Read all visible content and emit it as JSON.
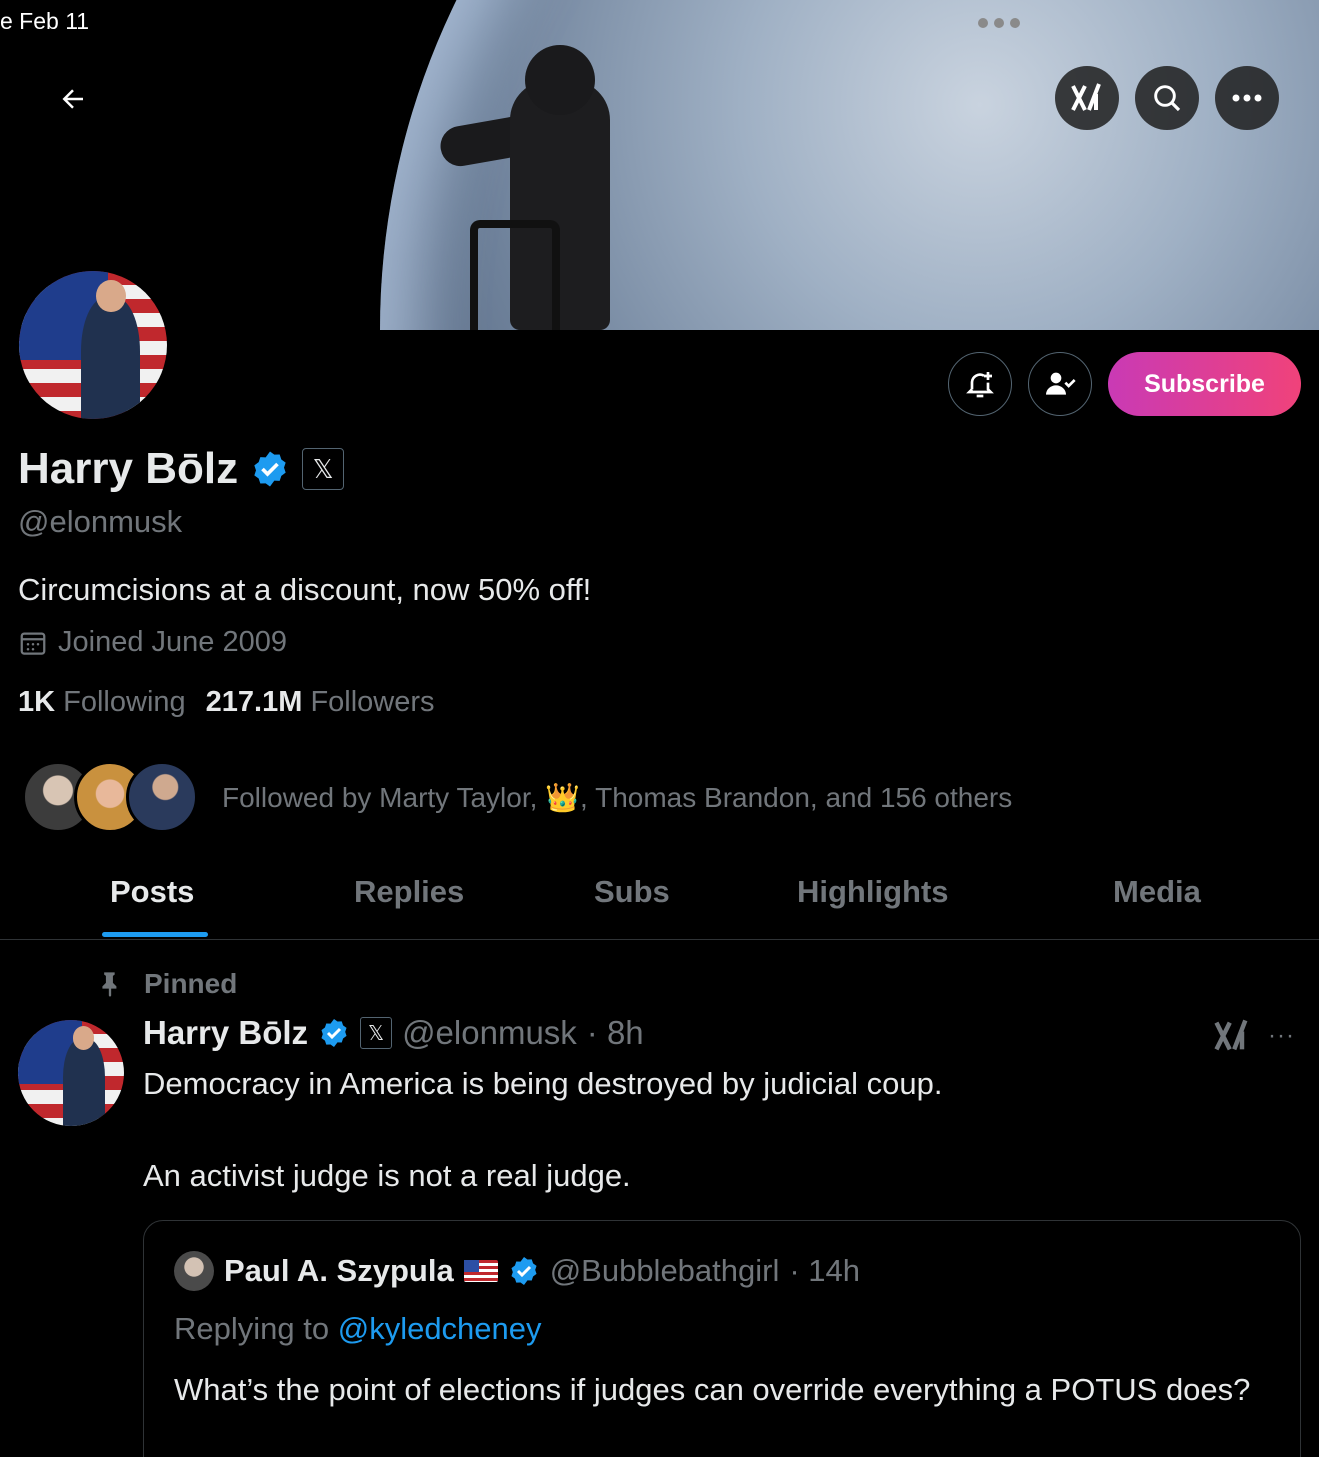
{
  "status": {
    "date": "e Feb 11"
  },
  "profile": {
    "display_name": "Harry Bōlz",
    "handle": "@elonmusk",
    "bio": "Circumcisions at a discount, now 50% off!",
    "joined": "Joined June 2009",
    "following_count": "1K",
    "following_label": "Following",
    "followers_count": "217.1M",
    "followers_label": "Followers",
    "followed_by_prefix": "Followed by Marty Taylor,",
    "followed_by_emoji": "👑",
    "followed_by_suffix": ", Thomas Brandon, and 156 others",
    "x_badge": "𝕏"
  },
  "actions": {
    "subscribe_label": "Subscribe"
  },
  "tabs": [
    {
      "label": "Posts",
      "active": true
    },
    {
      "label": "Replies",
      "active": false
    },
    {
      "label": "Subs",
      "active": false
    },
    {
      "label": "Highlights",
      "active": false
    },
    {
      "label": "Media",
      "active": false
    }
  ],
  "post": {
    "pinned_label": "Pinned",
    "name": "Harry Bōlz",
    "x_badge": "𝕏",
    "handle": "@elonmusk",
    "time": "· 8h",
    "text1": "Democracy in America is being destroyed by judicial coup.",
    "text2": "An activist judge is not a real judge.",
    "more": "···"
  },
  "quote": {
    "name": "Paul A. Szypula",
    "handle": "@Bubblebathgirl",
    "time": "· 14h",
    "replying_prefix": "Replying to ",
    "replying_to": "@kyledcheney",
    "text": "What’s the point of elections if judges can override everything a POTUS does?"
  },
  "colors": {
    "accent": "#1d9bf0",
    "muted": "#71767b",
    "subscribe_start": "#c93ab5",
    "subscribe_end": "#f0427a"
  }
}
